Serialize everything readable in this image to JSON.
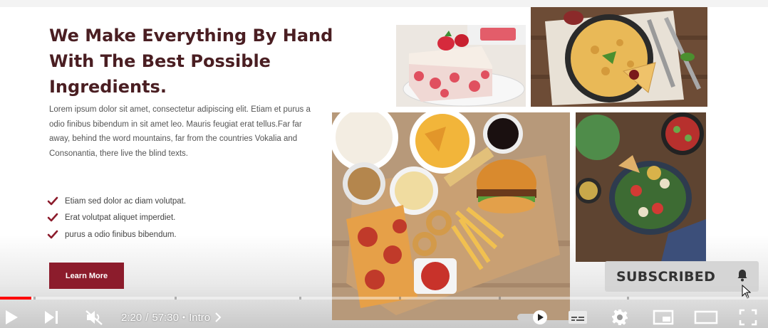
{
  "content": {
    "heading": "We Make Everything By Hand With The Best Possible Ingredients.",
    "body": "Lorem ipsum dolor sit amet, consectetur adipiscing elit. Etiam et purus a odio finibus bibendum in sit amet leo. Mauris feugiat erat tellus.Far far away, behind the word mountains, far from the countries Vokalia and Consonantia, there live the blind texts.",
    "checklist": [
      {
        "icon": "check-icon",
        "text": "Etiam sed dolor ac diam volutpat."
      },
      {
        "icon": "check-icon",
        "text": "Erat volutpat aliquet imperdiet."
      },
      {
        "icon": "check-icon",
        "text": "purus a odio finibus bibendum."
      }
    ],
    "button_label": "Learn More",
    "accent_color": "#8c1c2c",
    "heading_color": "#4a1e22"
  },
  "collage": {
    "photos": [
      "strawberry-cake",
      "quiche-tart",
      "fast-food-platter",
      "salad-bowl"
    ]
  },
  "overlay": {
    "subscribed_label": "SUBSCRIBED",
    "bell_icon": "bell-icon"
  },
  "player": {
    "current_time": "2:20",
    "duration": "57:30",
    "time_separator": "/",
    "chapter": "Intro",
    "progress_fraction": 0.0406,
    "buffered_fraction": 0.043,
    "progress_color": "#ff0000",
    "icons": [
      "play-icon",
      "next-icon",
      "mute-icon",
      "autoplay-toggle",
      "subtitles-icon",
      "settings-icon",
      "miniplayer-icon",
      "theater-icon",
      "fullscreen-icon"
    ]
  }
}
